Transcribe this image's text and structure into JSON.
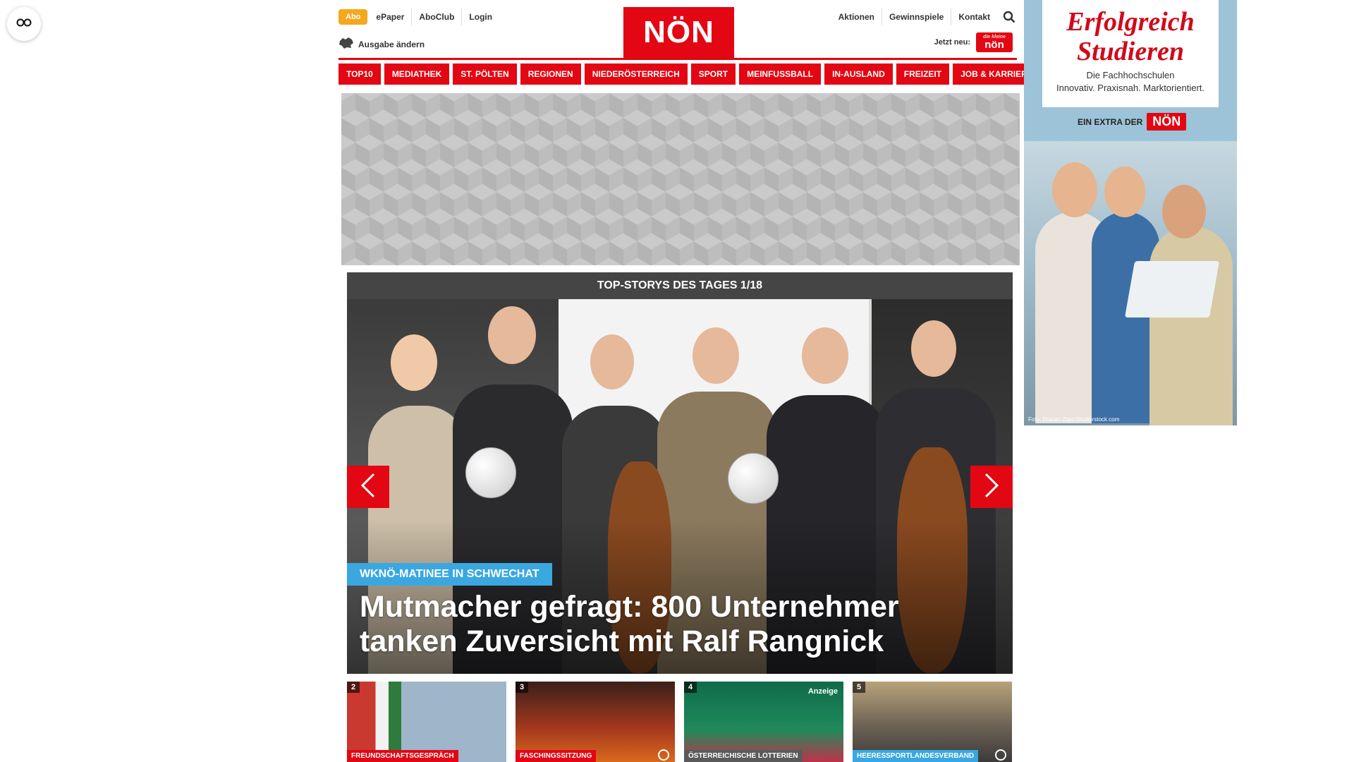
{
  "a11y": {
    "icon": "glasses-icon"
  },
  "header": {
    "abo_label": "Abo",
    "left_links": [
      "ePaper",
      "AboClub",
      "Login"
    ],
    "edition_label": "Ausgabe ändern",
    "logo_text": "NÖN",
    "right_links": [
      "Aktionen",
      "Gewinnspiele",
      "Kontakt"
    ],
    "jetzt_label": "Jetzt neu:",
    "jetzt_badge_small": "die kleine",
    "jetzt_badge_text": "nön",
    "accent_color": "#e30613",
    "abo_color": "#f4a81d"
  },
  "nav": {
    "items": [
      "TOP10",
      "MEDIATHEK",
      "ST. PÖLTEN",
      "REGIONEN",
      "NIEDERÖSTERREICH",
      "SPORT",
      "MEINFUSSBALL",
      "IN-AUSLAND",
      "FREIZEIT",
      "JOB & KARRIERE"
    ]
  },
  "stories": {
    "header": "TOP-STORYS DES TAGES 1/18",
    "hero": {
      "kicker": "WKNÖ-MATINEE IN SCHWECHAT",
      "title": "Mutmacher gefragt: 800 Unternehmer tanken Zuversicht mit Ralf Rangnick",
      "kicker_color": "#3aa7e0"
    },
    "thumbs": [
      {
        "num": "2",
        "label": "FREUNDSCHAFTSGESPRÄCH",
        "label_color": "#e30613"
      },
      {
        "num": "3",
        "label": "FASCHINGSSITZUNG",
        "label_color": "#e30613"
      },
      {
        "num": "4",
        "label": "ÖSTERREICHISCHE LOTTERIEN",
        "label_color": "#5a5a5a",
        "ad": "Anzeige"
      },
      {
        "num": "5",
        "label": "HEERESSPORTLANDESVERBAND",
        "label_color": "#3aa7e0"
      }
    ]
  },
  "side_ad": {
    "title_line1": "Erfolgreich",
    "title_line2": "Studieren",
    "sub_line1": "Die Fachhochschulen",
    "sub_line2": "Innovativ. Praxisnah. Marktorientiert.",
    "extra_label": "EIN EXTRA DER",
    "extra_badge": "NÖN",
    "credit": "Foto: Drazen Zigic/Shutterstock.com"
  }
}
